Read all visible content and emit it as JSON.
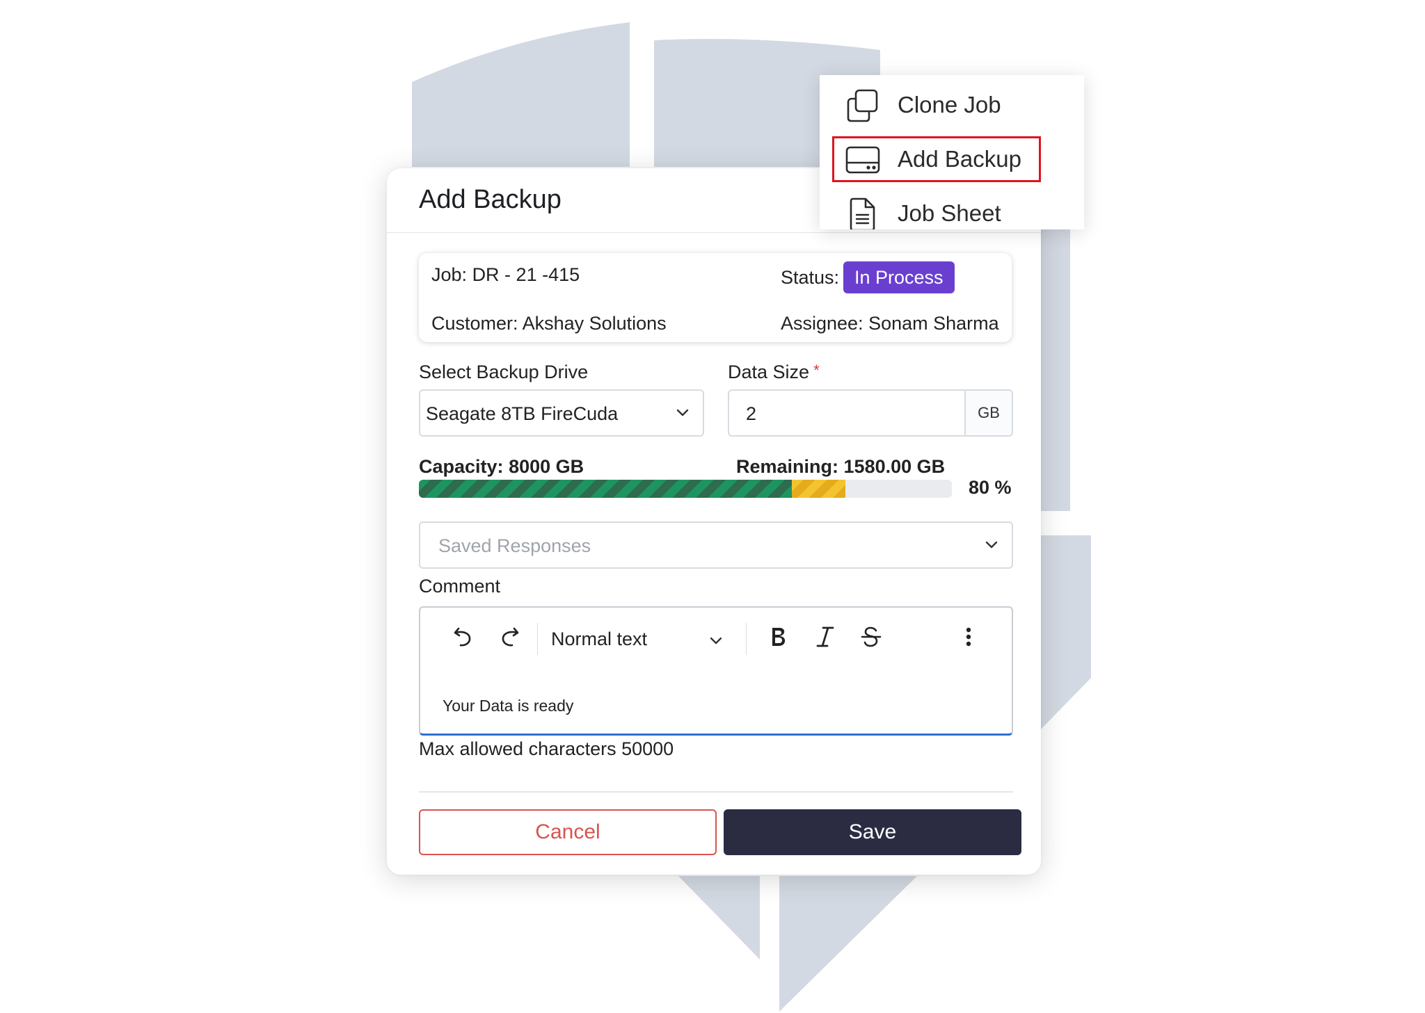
{
  "modal": {
    "title": "Add Backup"
  },
  "job_info": {
    "job_label": "Job:",
    "job_value": "DR - 21 -415",
    "status_label": "Status:",
    "status_value": "In Process",
    "customer_label": "Customer:",
    "customer_value": "Akshay Solutions",
    "assignee_label": "Assignee:",
    "assignee_value": "Sonam Sharma"
  },
  "form": {
    "drive_label": "Select Backup Drive",
    "drive_value": "Seagate 8TB FireCuda",
    "size_label": "Data Size",
    "size_required_mark": "*",
    "size_value": "2",
    "size_unit": "GB",
    "saved_responses_placeholder": "Saved Responses",
    "comment_label": "Comment",
    "text_style": "Normal text",
    "comment_value": "Your Data is ready",
    "max_chars_note": "Max allowed characters 50000"
  },
  "capacity": {
    "capacity_label": "Capacity:",
    "capacity_value": "8000",
    "capacity_unit": "GB",
    "remaining_label": "Remaining:",
    "remaining_value": "1580.00",
    "remaining_unit": "GB",
    "percent_text": "80 %",
    "used_fraction": 0.7,
    "new_fraction": 0.1,
    "used_color": "#1e9460",
    "new_color": "#f4c430"
  },
  "buttons": {
    "cancel": "Cancel",
    "save": "Save"
  },
  "menu": {
    "items": [
      {
        "label": "Clone Job",
        "icon": "clone-icon"
      },
      {
        "label": "Add Backup",
        "icon": "hard-drive-icon",
        "highlighted": true
      },
      {
        "label": "Job Sheet",
        "icon": "document-icon"
      }
    ]
  },
  "colors": {
    "status_badge": "#6a3fd0",
    "save_button": "#2b2c42",
    "cancel_border": "#d9534f",
    "highlight": "#e0141e"
  }
}
